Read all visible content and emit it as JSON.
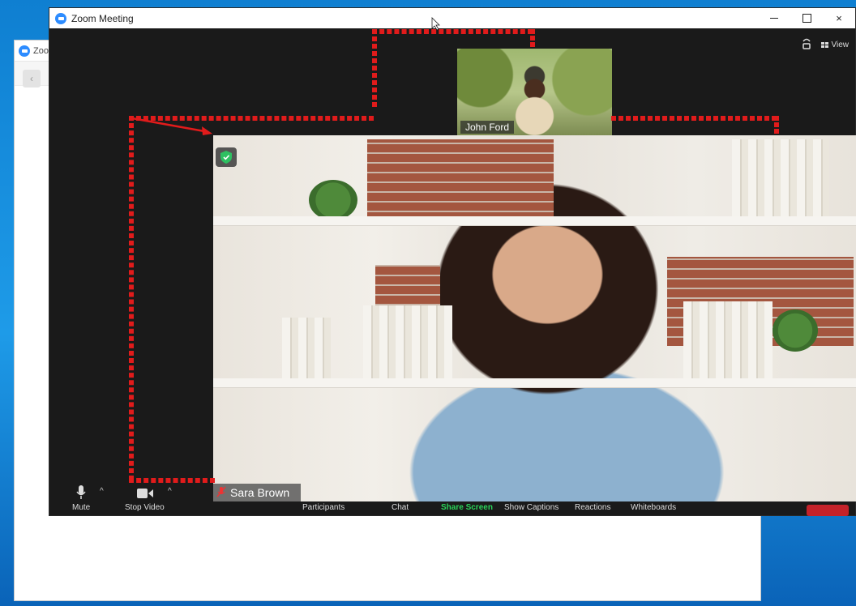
{
  "background_window": {
    "title": "Zoom Meeting",
    "back_icon": "chevron-left-icon"
  },
  "window": {
    "title": "Zoom Meeting",
    "controls": {
      "minimize": "minimize-icon",
      "maximize": "maximize-icon",
      "close": "×"
    }
  },
  "top_tools": {
    "view_label": "View",
    "view_icon": "grid-icon",
    "info_icon": "shield-info-icon"
  },
  "participants": {
    "thumbnail_name": "John Ford",
    "speaker_name": "Sara Brown",
    "speaker_muted_icon": "muted-mic-icon"
  },
  "encryption_icon": "green-shield-icon",
  "toolbar": {
    "mute_label": "Mute",
    "stop_video_label": "Stop Video",
    "participants_label": "Participants",
    "chat_label": "Chat",
    "share_screen_label": "Share Screen",
    "show_captions_label": "Show Captions",
    "reactions_label": "Reactions",
    "whiteboards_label": "Whiteboards",
    "caret": "^"
  },
  "colors": {
    "annotation": "#e11b1b",
    "share_screen": "#2ad35a",
    "end_button": "#c4222a",
    "zoom_blue": "#2d8cff"
  }
}
